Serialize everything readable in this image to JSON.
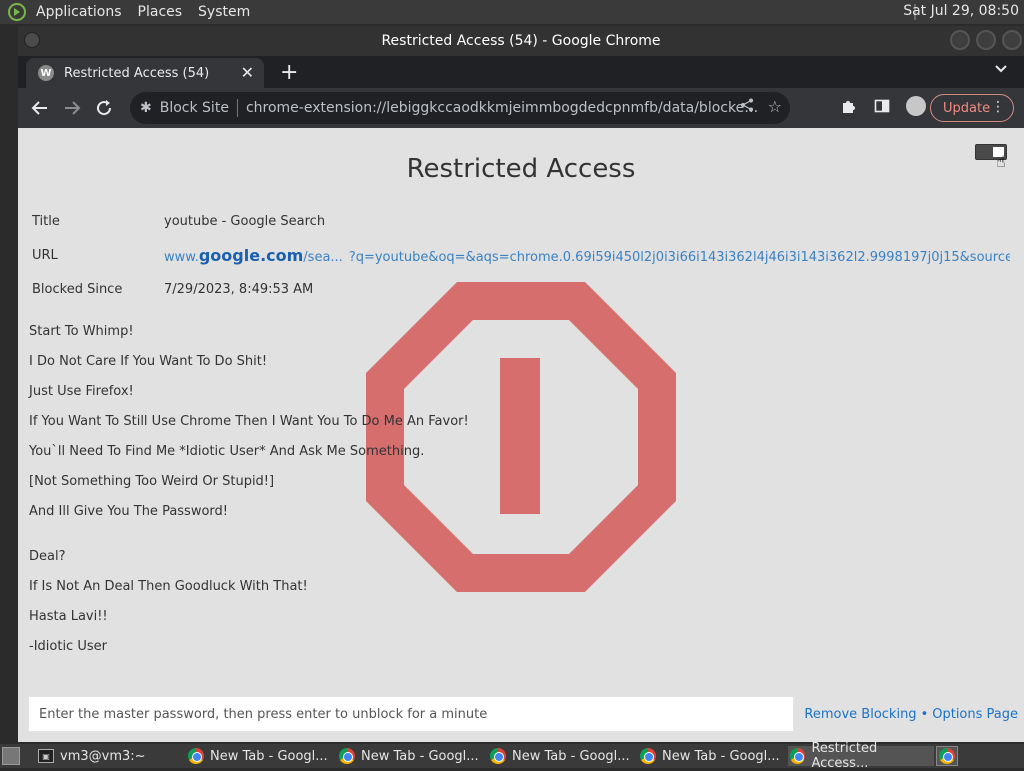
{
  "top_panel": {
    "menus": [
      "Applications",
      "Places",
      "System"
    ],
    "clock": "Sat Jul 29, 08:50"
  },
  "window": {
    "title": "Restricted Access (54) - Google Chrome"
  },
  "browser": {
    "tab_title": "Restricted Access (54)",
    "tab_favicon_letter": "W",
    "omnibox_chip": "Block Site",
    "omnibox_url": "chrome-extension://lebiggkccaodkkmjeimmbogdedcpnmfb/data/blocked/index.h...",
    "update_label": "Update"
  },
  "page": {
    "title": "Restricted Access",
    "rows": [
      {
        "key": "Title",
        "value": "youtube - Google Search"
      },
      {
        "key": "URL"
      },
      {
        "key": "Blocked Since",
        "value": "7/29/2023, 8:49:53 AM"
      }
    ],
    "url": {
      "prefix": "www.",
      "domain": "google.com",
      "path": "/sea...",
      "query": "?q=youtube&oq=&aqs=chrome.0.69i59i450l2j0i3i66i143i362l4j46i3i143i362l2.9998197j0j15&sourceid=chrome&ie=U..."
    },
    "message_lines": [
      "Start To Whimp!",
      "I Do Not Care If You Want To Do Shit!",
      "Just Use Firefox!",
      "If You Want To Still Use Chrome Then I Want You To Do Me An Favor!",
      "You`ll Need To Find Me *Idiotic User* And Ask Me Something.",
      "[Not Something Too Weird Or Stupid!]",
      "And Ill Give You The Password!",
      "Deal?",
      "If Is Not An Deal Then Goodluck With That!",
      "Hasta Lavi!!",
      "-Idiotic User"
    ],
    "password_placeholder": "Enter the master password, then press enter to unblock for a minute",
    "remove_blocking": "Remove Blocking",
    "link_separator": "•",
    "options_page": "Options Page",
    "stop_sign_color": "#d66e6e"
  },
  "taskbar": {
    "items": [
      {
        "label": "vm3@vm3:~",
        "type": "terminal"
      },
      {
        "label": "New Tab - Googl...",
        "type": "chrome"
      },
      {
        "label": "New Tab - Googl...",
        "type": "chrome"
      },
      {
        "label": "New Tab - Googl...",
        "type": "chrome"
      },
      {
        "label": "New Tab - Googl...",
        "type": "chrome"
      },
      {
        "label": "Restricted Access...",
        "type": "chrome",
        "active": true
      }
    ]
  }
}
